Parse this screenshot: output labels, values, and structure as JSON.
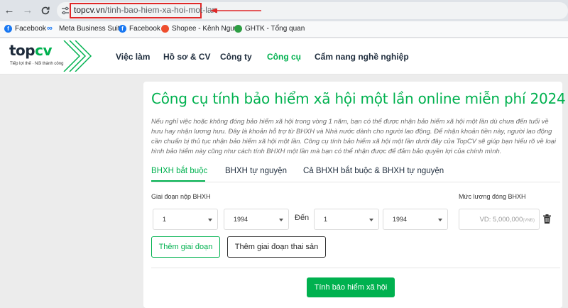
{
  "browser": {
    "url_host": "topcv.vn",
    "url_path": "/tinh-bao-hiem-xa-hoi-mot-lan"
  },
  "bookmarks": [
    {
      "label": "Facebook",
      "icon": "facebook-icon"
    },
    {
      "label": "Meta Business Suite",
      "icon": "meta-icon"
    },
    {
      "label": "Facebook",
      "icon": "facebook-icon"
    },
    {
      "label": "Shopee - Kênh Ngư...",
      "icon": "shopee-icon"
    },
    {
      "label": "GHTK - Tổng quan",
      "icon": "ghtk-icon"
    }
  ],
  "site": {
    "logo_top": "top",
    "logo_cv": "cv",
    "tagline": "Tiếp lợi thế · Nối thành công",
    "nav": [
      "Việc làm",
      "Hồ sơ & CV",
      "Công ty",
      "Công cụ",
      "Cẩm nang nghề nghiệp"
    ],
    "accent": "#00b14f"
  },
  "tool": {
    "title": "Công cụ tính bảo hiểm xã hội một lần online miễn phí 2024",
    "intro": "Nếu nghỉ việc hoặc không đóng bảo hiểm xã hội trong vòng 1 năm, bạn có thể được nhận bảo hiểm xã hội một lần dù chưa đến tuổi về hưu hay nhận lương hưu. Đây là khoản hỗ trợ từ BHXH và Nhà nước dành cho người lao động. Để nhận khoản tiền này, người lao động cần chuẩn bị thủ tục nhận bảo hiểm xã hội một lần. Công cụ tính bảo hiểm xã hội một lần dưới đây của TopCV sẽ giúp bạn hiểu rõ về loại hình bảo hiểm này cũng như cách tính BHXH một lần mà bạn có thể nhận được để đảm bảo quyền lợi của chính mình.",
    "tabs": [
      "BHXH bắt buộc",
      "BHXH tự nguyện",
      "Cả BHXH bắt buộc & BHXH tự nguyện"
    ],
    "period_label": "Giai đoạn nộp BHXH",
    "salary_label": "Mức lương đóng BHXH",
    "from_month": "1",
    "from_year": "1994",
    "to_label": "Đến",
    "to_month": "1",
    "to_year": "1994",
    "salary_placeholder": "VD: 5,000,000",
    "salary_unit": "(VNĐ)",
    "add_period": "Thêm giai đoạn",
    "add_maternity": "Thêm giai đoạn thai sản",
    "submit": "Tính bảo hiểm xã hội"
  }
}
